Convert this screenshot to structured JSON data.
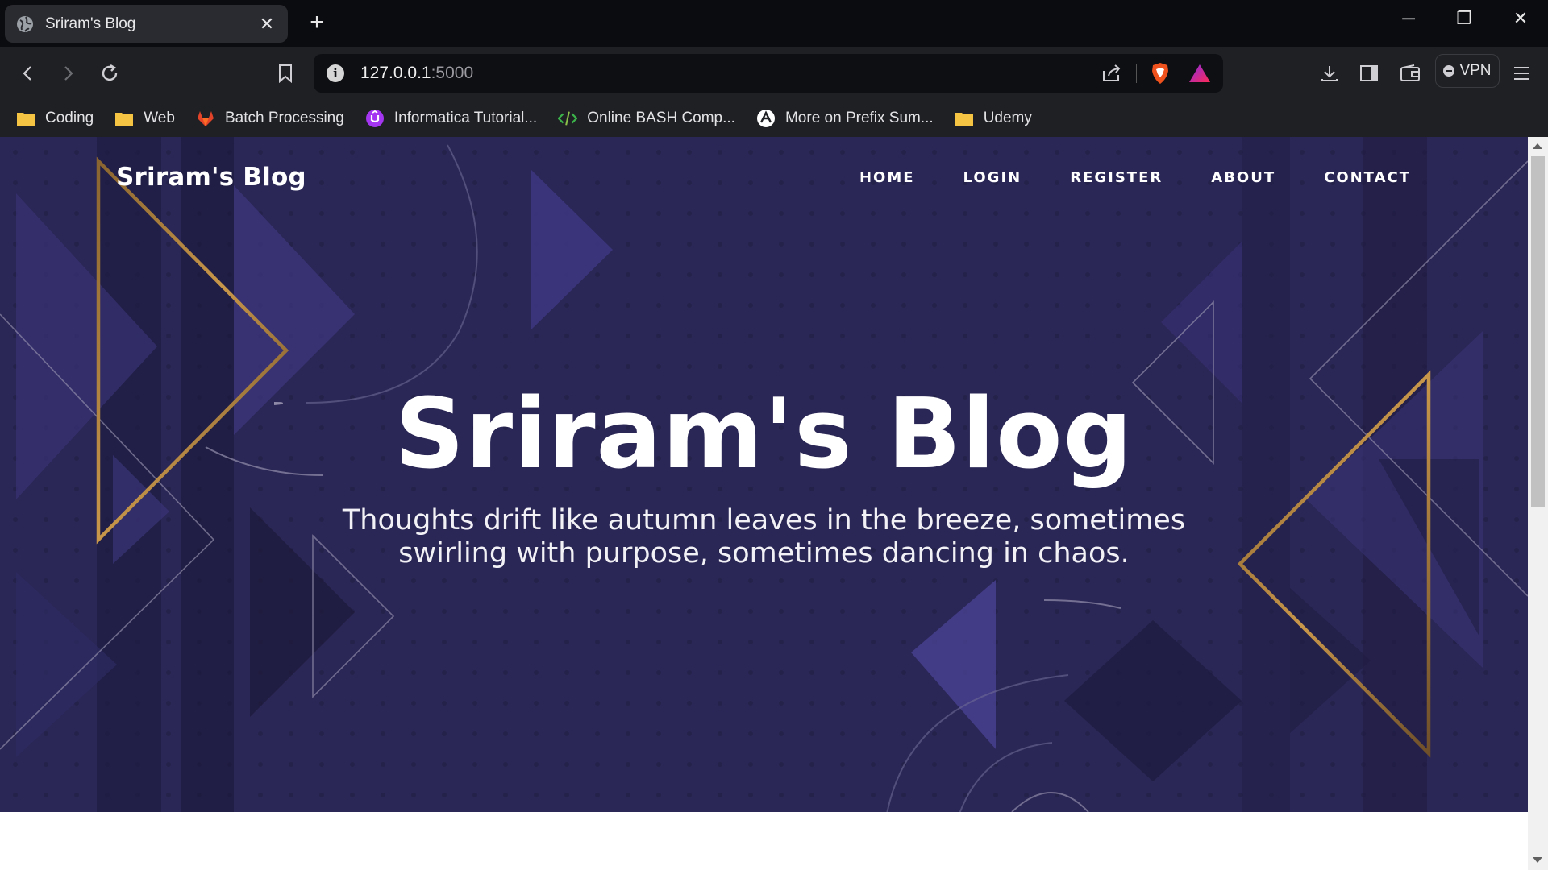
{
  "tab": {
    "title": "Sriram's Blog",
    "close": "✕"
  },
  "window": {
    "new_tab": "+",
    "minimize": "─",
    "restore": "❐",
    "close": "✕"
  },
  "address": {
    "host": "127.0.0.1",
    "port": ":5000"
  },
  "vpn_label": "VPN",
  "bookmarks": [
    {
      "label": "Coding",
      "icon": "folder-icon"
    },
    {
      "label": "Web",
      "icon": "folder-icon"
    },
    {
      "label": "Batch Processing",
      "icon": "gitlab-icon"
    },
    {
      "label": "Informatica Tutorial...",
      "icon": "udemy-icon"
    },
    {
      "label": "Online BASH Comp...",
      "icon": "code-icon"
    },
    {
      "label": "More on Prefix Sum...",
      "icon": "leetcode-icon"
    },
    {
      "label": "Udemy",
      "icon": "folder-icon"
    }
  ],
  "site": {
    "brand": "Sriram's Blog",
    "nav": [
      "HOME",
      "LOGIN",
      "REGISTER",
      "ABOUT",
      "CONTACT"
    ],
    "hero_title": "Sriram's Blog",
    "hero_subtitle": "Thoughts drift like autumn leaves in the breeze, sometimes swirling with purpose, sometimes dancing in chaos."
  },
  "colors": {
    "hero_bg": "#27234f",
    "accent_gold": "#a97a3a",
    "tab_bg": "#2a2b30",
    "toolbar_bg": "#1f2024"
  }
}
